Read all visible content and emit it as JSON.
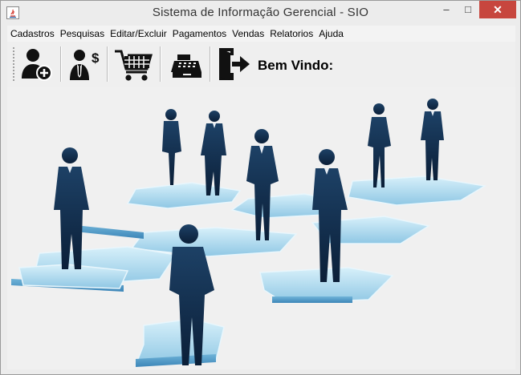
{
  "window": {
    "title": "Sistema de Informação Gerencial - SIO"
  },
  "window_controls": {
    "minimize": "–",
    "maximize": "□",
    "close": "✕"
  },
  "menu": [
    "Cadastros",
    "Pesquisas",
    "Editar/Excluir",
    "Pagamentos",
    "Vendas",
    "Relatorios",
    "Ajuda"
  ],
  "toolbar": {
    "buttons": [
      {
        "icon": "add-user-icon"
      },
      {
        "icon": "salesperson-money-icon"
      },
      {
        "icon": "shopping-cart-icon"
      },
      {
        "icon": "cash-register-icon"
      },
      {
        "icon": "exit-door-icon"
      }
    ],
    "welcome": "Bem Vindo:"
  },
  "background": {
    "image": "business-people-on-puzzle-pieces"
  },
  "colors": {
    "puzzle_light": "#b9dff0",
    "puzzle_dark": "#5ea7cf",
    "silhouette": "#0f2b4d",
    "close_button": "#c7463e"
  }
}
